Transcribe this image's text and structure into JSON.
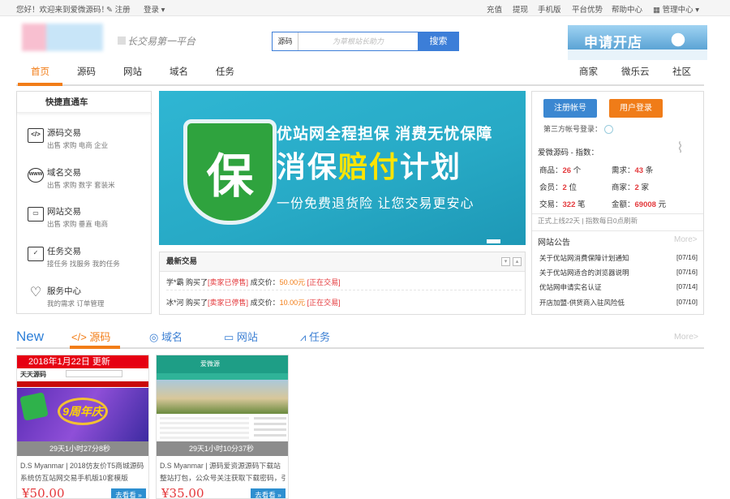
{
  "topbar": {
    "greeting": "您好！欢迎来到爱微源码！",
    "register": "注册",
    "login": "登录",
    "links": [
      "充值",
      "提现",
      "手机版",
      "平台优势",
      "帮助中心"
    ],
    "admin": "管理中心"
  },
  "header": {
    "slogan": "长交易第一平台",
    "search": {
      "category": "源码",
      "placeholder": "为草根站长助力",
      "button": "搜索"
    },
    "apply_banner": "申请开店"
  },
  "nav": {
    "left": [
      "首页",
      "源码",
      "网站",
      "域名",
      "任务"
    ],
    "right": [
      "商家",
      "微乐云",
      "社区"
    ],
    "active_index": 0
  },
  "sidebar": {
    "title": "快捷直通车",
    "items": [
      {
        "title": "源码交易",
        "icon": "code-icon",
        "sub": "出售  求购  电商  企业"
      },
      {
        "title": "域名交易",
        "icon": "www-icon",
        "sub": "出售  求购  数字  套装米"
      },
      {
        "title": "网站交易",
        "icon": "monitor-icon",
        "sub": "出售  求购  垂直  电商"
      },
      {
        "title": "任务交易",
        "icon": "calendar-icon",
        "sub": "接任务  找服务  我的任务"
      },
      {
        "title": "服务中心",
        "icon": "heart-icon",
        "sub": "我的需求  订单管理"
      }
    ]
  },
  "hero": {
    "shield": "保",
    "line1": "优站网全程担保 消费无忧保障",
    "line2a": "消保",
    "line2b": "赔付",
    "line2c": "计划",
    "line3": "一份免费退货险 让您交易更安心"
  },
  "trades": {
    "title": "最新交易",
    "rows": [
      {
        "user": "学*霸",
        "bought": "购买了",
        "item": "[卖家已停售]",
        "price_label": "成交价：",
        "price": "50.00元",
        "status": "[正在交易]"
      },
      {
        "user": "冰*河",
        "bought": "购买了",
        "item": "[卖家已停售]",
        "price_label": "成交价：",
        "price": "10.00元",
        "status": "[正在交易]"
      }
    ]
  },
  "account": {
    "register_button": "注册帐号",
    "login_button": "用户登录",
    "third_party": "第三方帐号登录：",
    "index_title": "爱微源码 - 指数：",
    "stats": [
      {
        "label": "商品：",
        "value": "26",
        "unit": "个"
      },
      {
        "label": "需求：",
        "value": "43",
        "unit": "条"
      },
      {
        "label": "会员：",
        "value": "2",
        "unit": "位"
      },
      {
        "label": "商家：",
        "value": "2",
        "unit": "家"
      },
      {
        "label": "交易：",
        "value": "322",
        "unit": "笔"
      },
      {
        "label": "金额：",
        "value": "69008",
        "unit": "元"
      }
    ],
    "since": "正式上线22天  |  指数每日0点刷新"
  },
  "notice": {
    "title": "网站公告",
    "more": "More>",
    "items": [
      {
        "text": "关于优站网消费保障计划通知",
        "date": "[07/16]"
      },
      {
        "text": "关于优站网适合的浏览器说明",
        "date": "[07/16]"
      },
      {
        "text": "优站网申请实名认证",
        "date": "[07/14]"
      },
      {
        "text": "开店加盟-供货商入驻风险低",
        "date": "[07/10]"
      }
    ]
  },
  "section": {
    "new_label": "New",
    "tabs": [
      {
        "label": "源码",
        "icon": "code-icon"
      },
      {
        "label": "域名",
        "icon": "dribbble-icon"
      },
      {
        "label": "网站",
        "icon": "monitor-icon"
      },
      {
        "label": "任务",
        "icon": "task-icon"
      }
    ],
    "more": "More>"
  },
  "cards": [
    {
      "img_banner": "2018年1月22日  更新",
      "site_name": "天天源码",
      "badge": "9周年庆",
      "time": "29天1小时27分8秒",
      "desc1": "D.S Myanmar | 2018仿友价T5商城源码",
      "desc2": "系统仿互站网交易手机版10套模版",
      "price": "¥50.00",
      "go": "去看看 »"
    },
    {
      "img_banner": "爱微源",
      "site_name": "爱微源码",
      "badge": "",
      "time": "29天1小时10分37秒",
      "desc1": "D.S Myanmar | 源码爱资源源码下载站",
      "desc2": "整站打包，公众号关注获取下载密码，引",
      "price": "¥35.00",
      "go": "去看看 »"
    }
  ]
}
